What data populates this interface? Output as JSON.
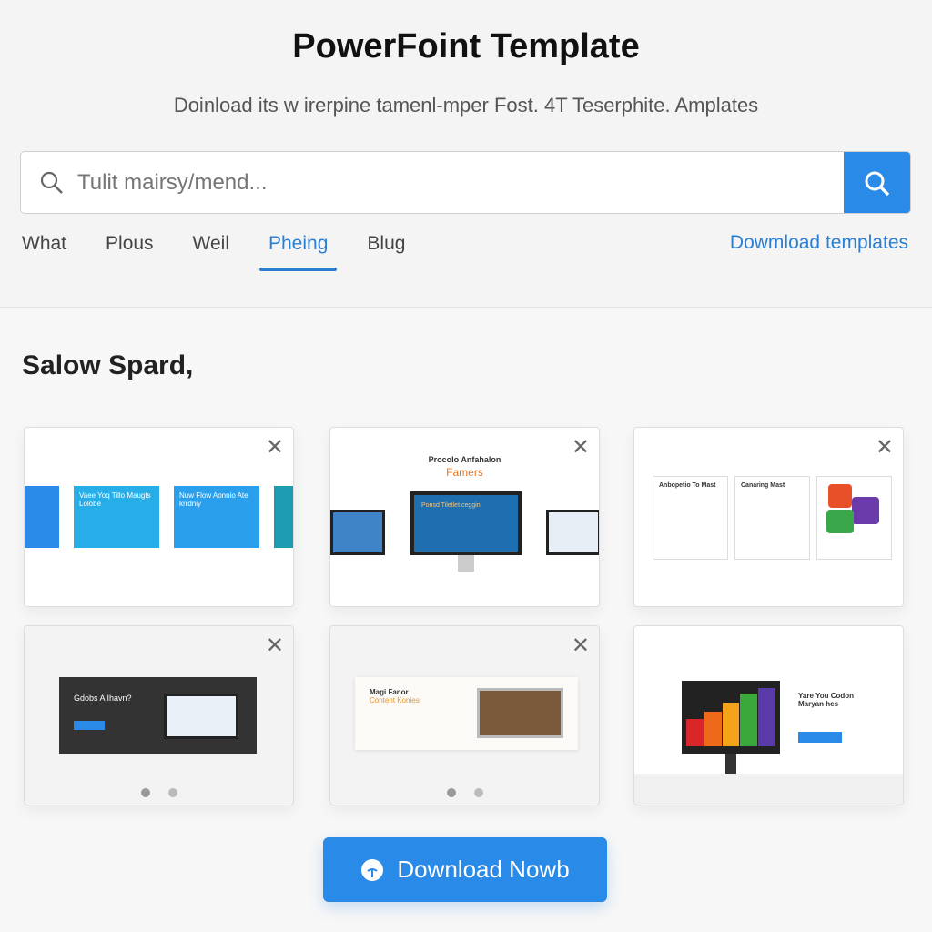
{
  "header": {
    "title": "PowerFoint Template",
    "subtitle": "Doinload its w irerpine tamenl-mper Fost. 4T Teserphite. Amplates"
  },
  "search": {
    "placeholder": "Tulit mairsy/mend...",
    "value": ""
  },
  "tabs": [
    {
      "label": "What"
    },
    {
      "label": "Plous"
    },
    {
      "label": "Weil"
    },
    {
      "label": "Pheing",
      "active": true
    },
    {
      "label": "Blug"
    }
  ],
  "download_link": "Dowmload templates",
  "section_title": "Salow Spard,",
  "cards": [
    {
      "texts": [
        "Vaee Yoq Tillo Maugts Lolobe",
        "Nuw Flow Aonnio Ate krrdniy"
      ]
    },
    {
      "texts": [
        "Procolo Anfahalon",
        "Famers",
        "Ponsd Tiletlet ceggin"
      ]
    },
    {
      "texts": [
        "Anbopetio To Mast",
        "Canaring Mast"
      ]
    },
    {
      "texts": [
        "Gdobs A Ihavn?"
      ]
    },
    {
      "texts": [
        "Magi Fanor",
        "Content Konies"
      ]
    },
    {
      "texts": [
        "Yare You Codon Maryan hes"
      ]
    }
  ],
  "download_button": "Download Nowb",
  "colors": {
    "accent": "#2a8ae8",
    "link": "#2a7fd4"
  }
}
